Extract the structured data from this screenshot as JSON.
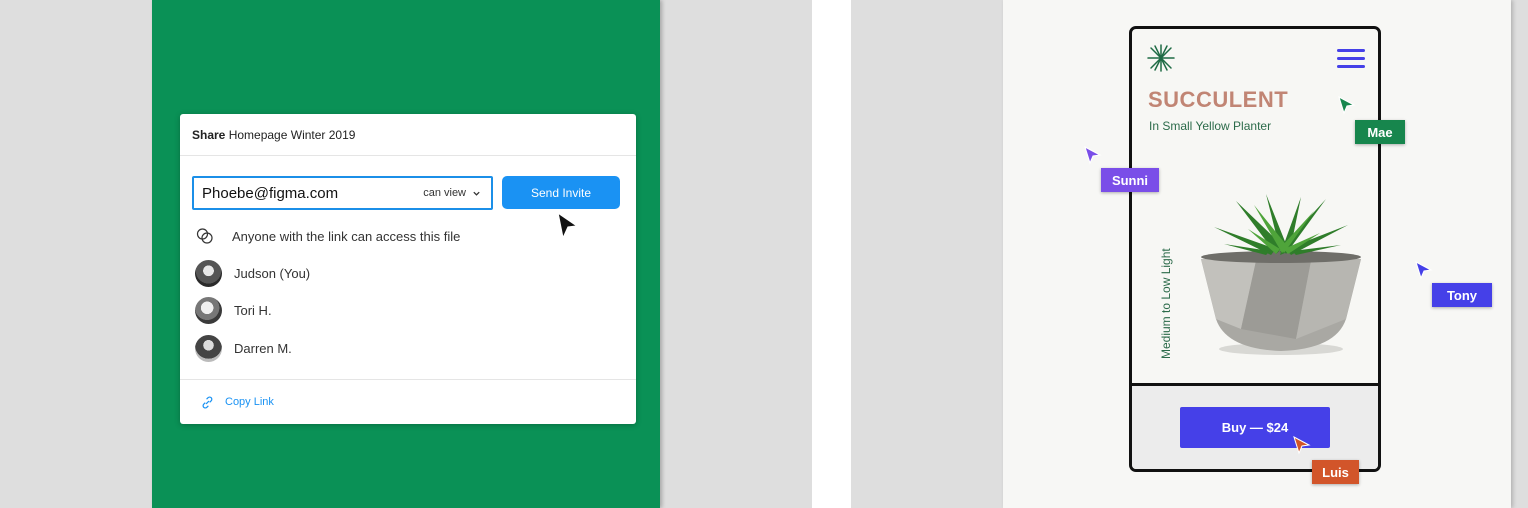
{
  "share_dialog": {
    "header_bold": "Share",
    "header_file": "Homepage Winter 2019",
    "email_value": "Phoebe@figma.com",
    "permission": "can view",
    "send_label": "Send Invite",
    "link_access": "Anyone with the link can access this file",
    "people": [
      {
        "name": "Judson (You)"
      },
      {
        "name": "Tori H."
      },
      {
        "name": "Darren M."
      }
    ],
    "copy_link": "Copy Link"
  },
  "mockup": {
    "title": "SUCCULENT",
    "subtitle": "In Small Yellow Planter",
    "light": "Medium to Low Light",
    "buy_label": "Buy — $24"
  },
  "collaborators": [
    {
      "name": "Mae",
      "color": "#17864d"
    },
    {
      "name": "Sunni",
      "color": "#7a4ee8"
    },
    {
      "name": "Tony",
      "color": "#4540e8"
    },
    {
      "name": "Luis",
      "color": "#d2552a"
    }
  ],
  "colors": {
    "canvas_bg": "#dedede",
    "green_board": "#0a9156",
    "accent_blue": "#1a92f3",
    "buy_button": "#4540e8",
    "title_color": "#c18574",
    "subtitle_color": "#2c6b4a"
  }
}
